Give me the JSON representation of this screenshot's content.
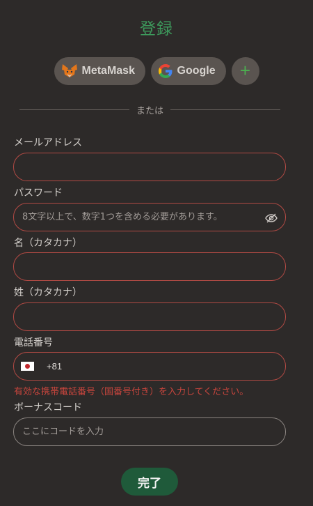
{
  "page": {
    "title": "登録"
  },
  "social": {
    "metamask_label": "MetaMask",
    "google_label": "Google",
    "more_label": "+"
  },
  "divider_text": "または",
  "form": {
    "email": {
      "label": "メールアドレス",
      "value": "",
      "placeholder": ""
    },
    "password": {
      "label": "パスワード",
      "value": "",
      "placeholder": "8文字以上で、数字1つを含める必要があります。"
    },
    "first_name": {
      "label": "名（カタカナ）",
      "value": "",
      "placeholder": ""
    },
    "last_name": {
      "label": "姓（カタカナ）",
      "value": "",
      "placeholder": ""
    },
    "phone": {
      "label": "電話番号",
      "country_code": "+81",
      "flag": "jp-flag-icon",
      "value": "",
      "placeholder": ""
    },
    "phone_error": "有効な携帯電話番号（国番号付き）を入力してください。",
    "bonus": {
      "label": "ボーナスコード",
      "value": "",
      "placeholder": "ここにコードを入力"
    }
  },
  "submit_label": "完了",
  "colors": {
    "background": "#2d2a29",
    "accent_green": "#3d9a5c",
    "error_red": "#c7453d",
    "submit_bg": "#1f5a3a"
  }
}
